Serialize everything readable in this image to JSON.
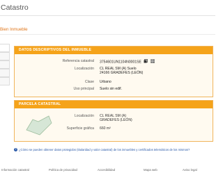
{
  "header": {
    "title": "Catastro"
  },
  "breadcrumb": {
    "label": "Bien Inmueble"
  },
  "descriptive": {
    "title": "DATOS DESCRIPTIVOS DEL INMUEBLE",
    "rows": [
      {
        "label": "Referencia catastral",
        "value": "3754601UN1104N0001SE"
      },
      {
        "label": "Localización",
        "value": "CL REAL SM (A) Suelo",
        "value2": "24166 GRADEFES (LEÓN)"
      },
      {
        "label": "Clase",
        "value": "Urbano"
      },
      {
        "label": "Uso principal",
        "value": "Suelo sin edif."
      }
    ]
  },
  "parcel": {
    "title": "PARCELA CATASTRAL",
    "location_label": "Localización",
    "location_value": "CL REAL SM (A)",
    "location_value2": "GRADEFES (LEÓN)",
    "area_label": "Superficie gráfica",
    "area_value": "660 m²"
  },
  "help_text": "¿Cómo se pueden obtener datos protegidos (titularidad y valor catastral) de los inmuebles y certificados telemáticos de los mismos?",
  "footer": {
    "items": [
      "Información catastral",
      "Política de privacidad",
      "Accesibilidad",
      "Mapa web",
      "Aviso legal"
    ]
  },
  "colors": {
    "accent": "#f5a31a",
    "breadcrumb": "#e0761b",
    "link": "#2b5aa8"
  }
}
